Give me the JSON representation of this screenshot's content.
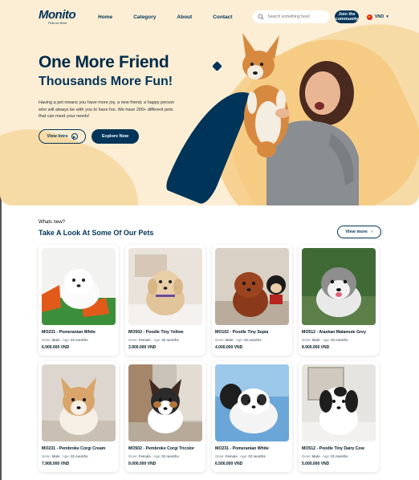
{
  "nav": {
    "logo": "Monito",
    "logo_tagline": "Pets for Best",
    "links": [
      "Home",
      "Category",
      "About",
      "Contact"
    ],
    "search_placeholder": "Search something here!",
    "join_label": "Join the community",
    "currency": "VND"
  },
  "hero": {
    "title_line1": "One More Friend",
    "title_line2": "Thousands More Fun!",
    "description": "Having a pet means you have more joy, a new friend, a happy person who will always be with you to have fun. We have 200+ different pets that can meet your needs!",
    "intro_label": "View Intro",
    "explore_label": "Explore Now"
  },
  "section": {
    "kicker": "Whats new?",
    "title": "Take A Look At Some Of Our Pets",
    "view_more_label": "View more"
  },
  "pets": [
    {
      "name": "MO231 - Pomeranian White",
      "gene_label": "Gene:",
      "gene": "Male",
      "age_label": "Age:",
      "age": "02 months",
      "price": "6.900.000 VND"
    },
    {
      "name": "MO502 - Poodle Tiny Yellow",
      "gene_label": "Gene:",
      "gene": "Female",
      "age_label": "Age:",
      "age": "02 months",
      "price": "3.900.000 VND"
    },
    {
      "name": "MO102 - Poodle Tiny Sepia",
      "gene_label": "Gene:",
      "gene": "Male",
      "age_label": "Age:",
      "age": "02 months",
      "price": "4.000.000 VND"
    },
    {
      "name": "MO512 - Alaskan Malamute Grey",
      "gene_label": "Gene:",
      "gene": "Male",
      "age_label": "Age:",
      "age": "02 months",
      "price": "8.900.000 VND"
    },
    {
      "name": "MO231 - Pembroke Corgi Cream",
      "gene_label": "Gene:",
      "gene": "Male",
      "age_label": "Age:",
      "age": "02 months",
      "price": "7.900.000 VND"
    },
    {
      "name": "MO502 - Pembroke Corgi Tricolor",
      "gene_label": "Gene:",
      "gene": "Female",
      "age_label": "Age:",
      "age": "02 months",
      "price": "9.000.000 VND"
    },
    {
      "name": "MO231 - Pomeranian White",
      "gene_label": "Gene:",
      "gene": "Female",
      "age_label": "Age:",
      "age": "02 months",
      "price": "6.500.000 VND"
    },
    {
      "name": "MO512 - Poodle Tiny Dairy Cow",
      "gene_label": "Gene:",
      "gene": "Male",
      "age_label": "Age:",
      "age": "02 months",
      "price": "5.000.000 VND"
    }
  ],
  "colors": {
    "primary": "#003459",
    "hero_bg": "#FCEED5",
    "accent": "#F7DBA7"
  }
}
